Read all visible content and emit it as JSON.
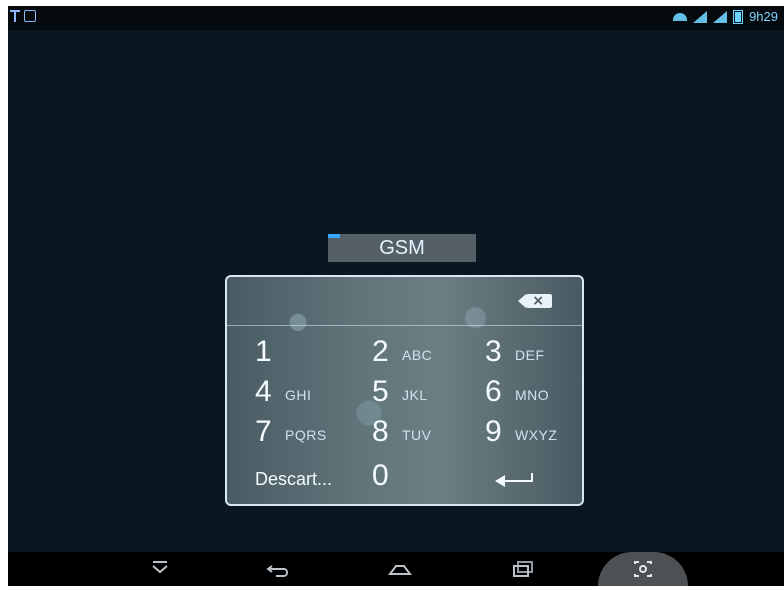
{
  "status_bar": {
    "time": "9h29",
    "left_icons": [
      "usb-icon",
      "notification-icon"
    ],
    "right_icons": [
      "wifi-icon",
      "signal-1-icon",
      "signal-2-icon",
      "battery-icon"
    ]
  },
  "network_label": "GSM",
  "pin_pad": {
    "keys": [
      {
        "num": "1",
        "letters": ""
      },
      {
        "num": "2",
        "letters": "ABC"
      },
      {
        "num": "3",
        "letters": "DEF"
      },
      {
        "num": "4",
        "letters": "GHI"
      },
      {
        "num": "5",
        "letters": "JKL"
      },
      {
        "num": "6",
        "letters": "MNO"
      },
      {
        "num": "7",
        "letters": "PQRS"
      },
      {
        "num": "8",
        "letters": "TUV"
      },
      {
        "num": "9",
        "letters": "WXYZ"
      }
    ],
    "descart_label": "Descart...",
    "zero_label": "0",
    "backspace_icon": "backspace-icon",
    "enter_icon": "enter-icon"
  },
  "nav_bar": {
    "icons": [
      "hide-keyboard-icon",
      "back-icon",
      "home-icon",
      "recents-icon",
      "screenshot-icon"
    ]
  }
}
